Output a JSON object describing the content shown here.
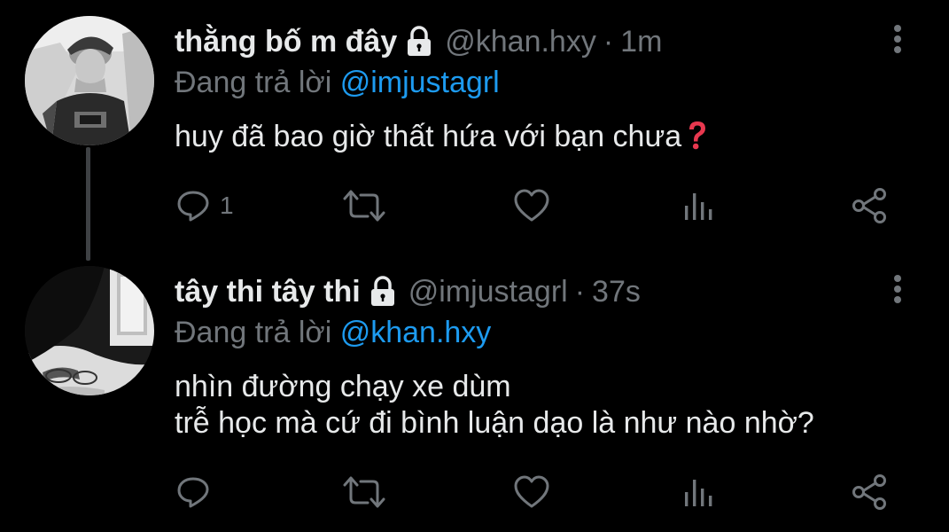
{
  "colors": {
    "background": "#000000",
    "primary_text": "#e7e9ea",
    "secondary_text": "#71767b",
    "link": "#1d9bf0",
    "thread_line": "#3e4144"
  },
  "tweets": [
    {
      "display_name": "thằng bố m đây",
      "handle": "@khan.hxy",
      "separator": "·",
      "time": "1m",
      "replying_to_prefix": "Đang trả lời",
      "replying_to_handle": "@imjustagrl",
      "body_lines": [
        "huy đã bao giờ thất hứa với bạn chưa"
      ],
      "emoji": "red-question-mark",
      "reply_count": "1",
      "icons": [
        "lock-icon",
        "more-icon",
        "reply-icon",
        "retweet-icon",
        "like-icon",
        "analytics-icon",
        "share-icon"
      ]
    },
    {
      "display_name": "tây thi tây thi",
      "handle": "@imjustagrl",
      "separator": "·",
      "time": "37s",
      "replying_to_prefix": "Đang trả lời",
      "replying_to_handle": "@khan.hxy",
      "body_lines": [
        "nhìn đường chạy xe dùm",
        "trễ học mà cứ đi bình luận dạo là như nào nhờ?"
      ],
      "reply_count": "",
      "icons": [
        "lock-icon",
        "more-icon",
        "reply-icon",
        "retweet-icon",
        "like-icon",
        "analytics-icon",
        "share-icon"
      ]
    }
  ]
}
